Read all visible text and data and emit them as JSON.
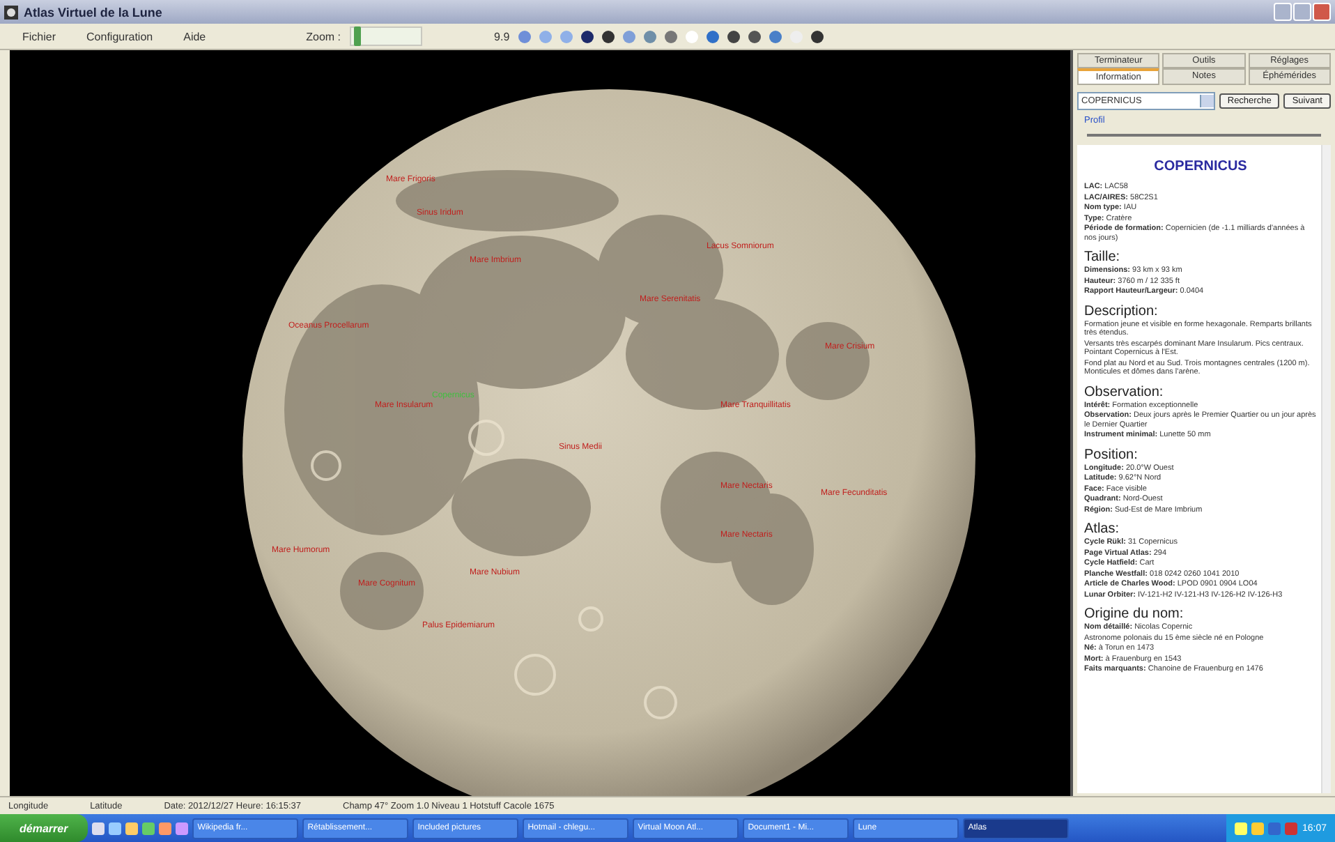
{
  "window": {
    "title": "Atlas Virtuel de la Lune"
  },
  "menu": [
    "Fichier",
    "Configuration",
    "Aide"
  ],
  "toolbar": {
    "zoom_label": "Zoom :",
    "level": 0.05,
    "zoom_value": "9.9"
  },
  "map_labels": [
    {
      "text": "Mare Frigoris",
      "kind": "feature"
    },
    {
      "text": "Sinus Iridum",
      "kind": "feature"
    },
    {
      "text": "Mare Imbrium",
      "kind": "feature"
    },
    {
      "text": "Lacus Somniorum",
      "kind": "feature"
    },
    {
      "text": "Mare Serenitatis",
      "kind": "feature"
    },
    {
      "text": "Oceanus Procellarum",
      "kind": "feature"
    },
    {
      "text": "Mare Crisium",
      "kind": "feature"
    },
    {
      "text": "Copernicus",
      "kind": "selected"
    },
    {
      "text": "Mare Insularum",
      "kind": "feature"
    },
    {
      "text": "Mare Tranquillitatis",
      "kind": "feature"
    },
    {
      "text": "Sinus Medii",
      "kind": "feature"
    },
    {
      "text": "Mare Nectaris",
      "kind": "feature"
    },
    {
      "text": "Mare Fecunditatis",
      "kind": "feature"
    },
    {
      "text": "Mare Humorum",
      "kind": "feature"
    },
    {
      "text": "Mare Nubium",
      "kind": "feature"
    },
    {
      "text": "Mare Nectaris",
      "kind": "feature"
    },
    {
      "text": "Mare Cognitum",
      "kind": "feature"
    },
    {
      "text": "Palus Epidemiarum",
      "kind": "feature"
    }
  ],
  "panel": {
    "tabs_top": [
      {
        "label": "Terminateur",
        "selected": false
      },
      {
        "label": "Outils",
        "selected": false
      },
      {
        "label": "Réglages",
        "selected": false
      }
    ],
    "tabs_bottom": [
      {
        "label": "Information",
        "selected": true
      },
      {
        "label": "Notes",
        "selected": false
      },
      {
        "label": "Éphémérides",
        "selected": false
      }
    ],
    "search": {
      "value": "COPERNICUS"
    },
    "buttons": [
      "Recherche",
      "Suivant"
    ],
    "profile": {
      "label": "Profil"
    },
    "info": {
      "title": "COPERNICUS",
      "sections": [
        {
          "lines": [
            {
              "label": "LAC:",
              "value": "LAC58"
            },
            {
              "label": "LAC/AIRES:",
              "value": "58C2S1"
            },
            {
              "label": "Nom type:",
              "value": "IAU"
            },
            {
              "label": "Type:",
              "value": "Cratère"
            },
            {
              "label": "Période de formation:",
              "value": "Copernicien (de -1.1 milliards d'années à nos jours)"
            }
          ]
        },
        {
          "heading": "Taille:",
          "lines": [
            {
              "label": "Dimensions:",
              "value": "93 km x 93 km"
            },
            {
              "label": "Hauteur:",
              "value": "3760 m / 12 335 ft"
            },
            {
              "label": "Rapport Hauteur/Largeur:",
              "value": "0.0404"
            }
          ]
        },
        {
          "heading": "Description:",
          "lines": [
            {
              "value": "Formation jeune et visible en forme hexagonale. Remparts brillants très étendus."
            },
            {
              "value": "Versants très escarpés dominant Mare Insularum. Pics centraux. Pointant Copernicus à l'Est."
            },
            {
              "value": "Fond plat au Nord et au Sud. Trois montagnes centrales (1200 m). Monticules et dômes dans l'arène."
            }
          ]
        },
        {
          "heading": "Observation:",
          "lines": [
            {
              "label": "Intérêt:",
              "value": "Formation exceptionnelle"
            },
            {
              "label": "Observation:",
              "value": "Deux jours après le Premier Quartier ou un jour après le Dernier Quartier"
            },
            {
              "label": "Instrument minimal:",
              "value": "Lunette 50 mm"
            }
          ]
        },
        {
          "heading": "Position:",
          "lines": [
            {
              "label": "Longitude:",
              "value": "20.0°W Ouest"
            },
            {
              "label": "Latitude:",
              "value": "9.62°N Nord"
            },
            {
              "label": "Face:",
              "value": "Face visible"
            },
            {
              "label": "Quadrant:",
              "value": "Nord-Ouest"
            },
            {
              "label": "Région:",
              "value": "Sud-Est de Mare Imbrium"
            }
          ]
        },
        {
          "heading": "Atlas:",
          "lines": [
            {
              "label": "Cycle Rükl:",
              "value": "31 Copernicus"
            },
            {
              "label": "Page Virtual Atlas:",
              "value": "294"
            },
            {
              "label": "Cycle Hatfield:",
              "value": "Cart"
            },
            {
              "label": "Planche Westfall:",
              "value": "018 0242 0260 1041 2010"
            },
            {
              "label": "Article de Charles Wood:",
              "value": "LPOD 0901 0904 LO04"
            },
            {
              "label": "Lunar Orbiter:",
              "value": "IV-121-H2 IV-121-H3 IV-126-H2 IV-126-H3"
            }
          ]
        },
        {
          "heading": "Origine du nom:",
          "lines": [
            {
              "label": "Nom détaillé:",
              "value": "Nicolas Copernic"
            },
            {
              "value": "Astronome polonais du 15 ème siècle né en Pologne"
            },
            {
              "label": "Né:",
              "value": "à Torun en 1473"
            },
            {
              "label": "Mort:",
              "value": "à Frauenburg en 1543"
            },
            {
              "label": "Faits marquants:",
              "value": "Chanoine de Frauenburg en 1476"
            }
          ]
        }
      ]
    }
  },
  "status_bar": [
    "Longitude",
    "Latitude",
    "Date: 2012/12/27  Heure: 16:15:37",
    "Champ 47° Zoom 1.0  Niveau 1  Hotstuff Cacole 1675"
  ],
  "taskbar": {
    "start": "démarrer",
    "tasks": [
      {
        "label": "Wikipedia fr...",
        "selected": false
      },
      {
        "label": "Rétablissement...",
        "selected": false
      },
      {
        "label": "Included pictures",
        "selected": false
      },
      {
        "label": "Hotmail - chlegu...",
        "selected": false
      },
      {
        "label": "Virtual Moon Atl...",
        "selected": false
      },
      {
        "label": "Document1 - Mi...",
        "selected": false
      },
      {
        "label": "Lune",
        "selected": false
      },
      {
        "label": "Atlas",
        "selected": true
      }
    ],
    "clock": "16:07"
  }
}
